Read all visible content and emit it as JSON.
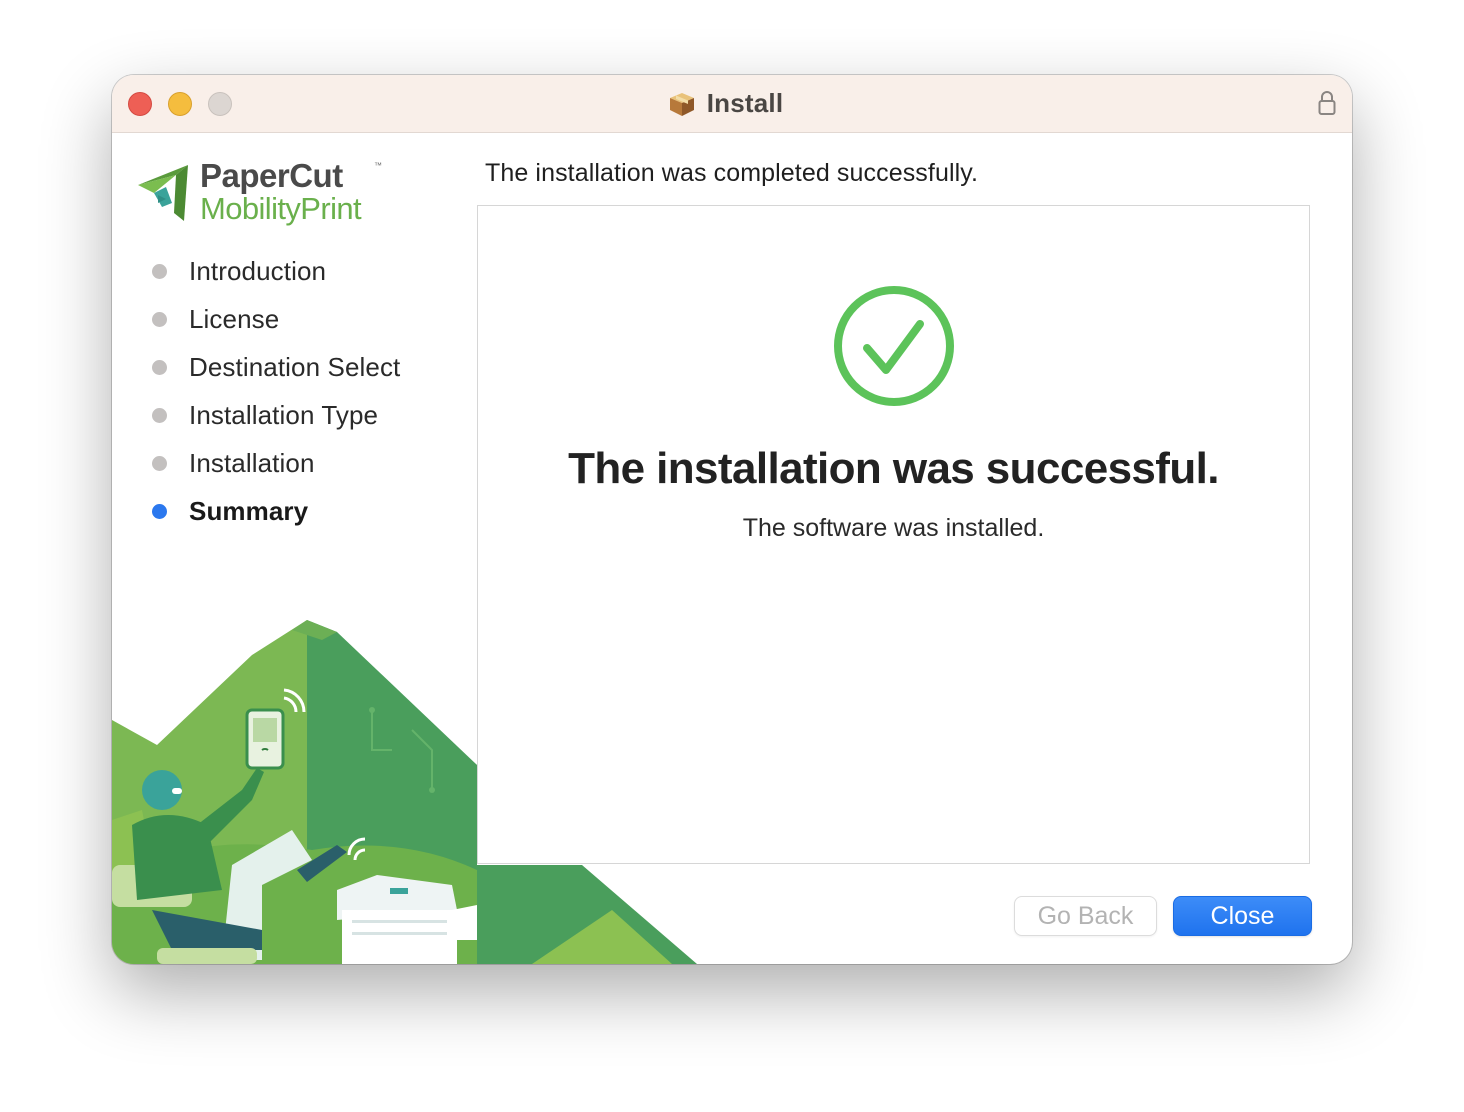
{
  "window": {
    "title": "Install",
    "icon": "package-icon"
  },
  "brand": {
    "name_top": "PaperCut",
    "trademark": "™",
    "name_bottom": "MobilityPrint",
    "colors": {
      "green": "#6ab04c",
      "dark": "#4a4a4a"
    }
  },
  "steps": [
    {
      "label": "Introduction",
      "active": false
    },
    {
      "label": "License",
      "active": false
    },
    {
      "label": "Destination Select",
      "active": false
    },
    {
      "label": "Installation Type",
      "active": false
    },
    {
      "label": "Installation",
      "active": false
    },
    {
      "label": "Summary",
      "active": true
    }
  ],
  "main": {
    "heading": "The installation was completed successfully.",
    "success_title": "The installation was successful.",
    "success_sub": "The software was installed."
  },
  "buttons": {
    "back_label": "Go Back",
    "close_label": "Close"
  },
  "colors": {
    "accent": "#2b78ee",
    "success": "#5cc35a"
  }
}
